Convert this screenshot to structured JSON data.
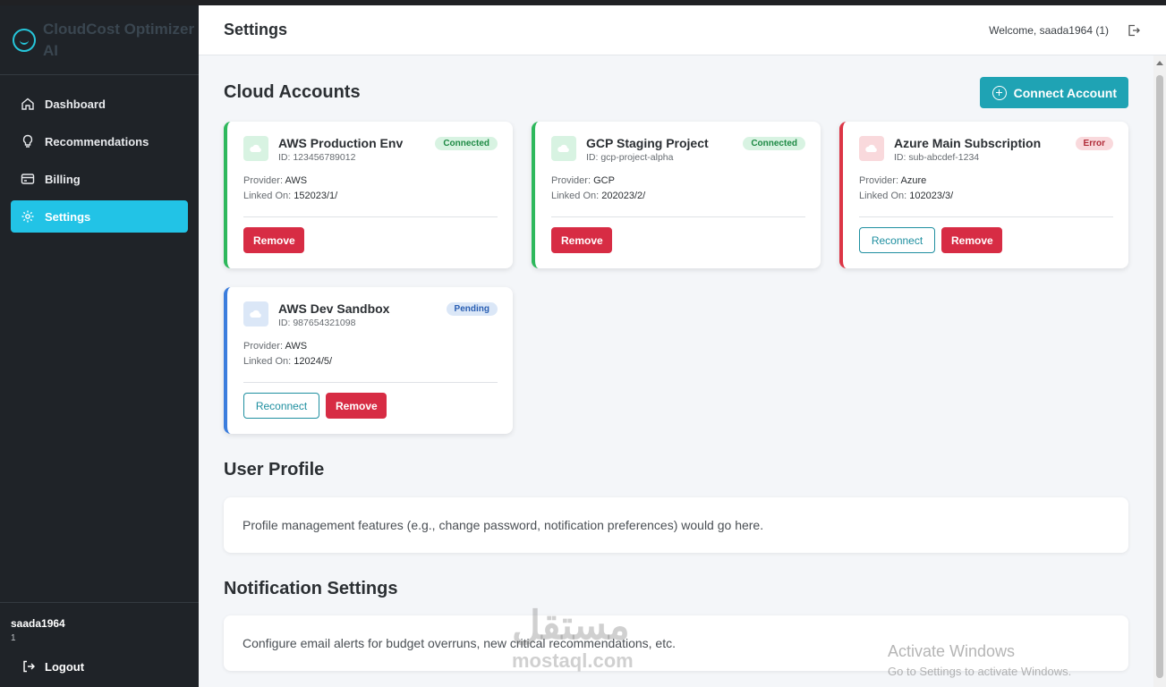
{
  "app": {
    "brand": "CloudCost Optimizer AI"
  },
  "sidebar": {
    "items": [
      {
        "label": "Dashboard",
        "icon": "home-icon"
      },
      {
        "label": "Recommendations",
        "icon": "lightbulb-icon"
      },
      {
        "label": "Billing",
        "icon": "credit-card-icon"
      },
      {
        "label": "Settings",
        "icon": "gear-icon",
        "active": true
      }
    ],
    "user": {
      "name": "saada1964",
      "id": "1"
    },
    "logout_label": "Logout"
  },
  "header": {
    "title": "Settings",
    "welcome": "Welcome, saada1964 (1)"
  },
  "cloud_accounts": {
    "title": "Cloud Accounts",
    "connect_label": "Connect Account",
    "provider_label": "Provider:",
    "linked_label": "Linked On:",
    "reconnect_label": "Reconnect",
    "remove_label": "Remove",
    "accounts": [
      {
        "name": "AWS Production Env",
        "id": "ID: 123456789012",
        "status": "Connected",
        "provider": "AWS",
        "linked": "152023/1/"
      },
      {
        "name": "GCP Staging Project",
        "id": "ID: gcp-project-alpha",
        "status": "Connected",
        "provider": "GCP",
        "linked": "202023/2/"
      },
      {
        "name": "Azure Main Subscription",
        "id": "ID: sub-abcdef-1234",
        "status": "Error",
        "provider": "Azure",
        "linked": "102023/3/"
      },
      {
        "name": "AWS Dev Sandbox",
        "id": "ID: 987654321098",
        "status": "Pending",
        "provider": "AWS",
        "linked": "12024/5/"
      }
    ]
  },
  "user_profile": {
    "title": "User Profile",
    "text": "Profile management features (e.g., change password, notification preferences) would go here."
  },
  "notifications": {
    "title": "Notification Settings",
    "text": "Configure email alerts for budget overruns, new critical recommendations, etc."
  },
  "overlay": {
    "watermark_text": "مستقل",
    "watermark_sub": "mostaql.com",
    "activate_title": "Activate Windows",
    "activate_sub": "Go to Settings to activate Windows."
  },
  "colors": {
    "accent": "#22c3e6",
    "connected": "#2eb85c",
    "error": "#dc3545",
    "pending": "#3b7ddd"
  }
}
